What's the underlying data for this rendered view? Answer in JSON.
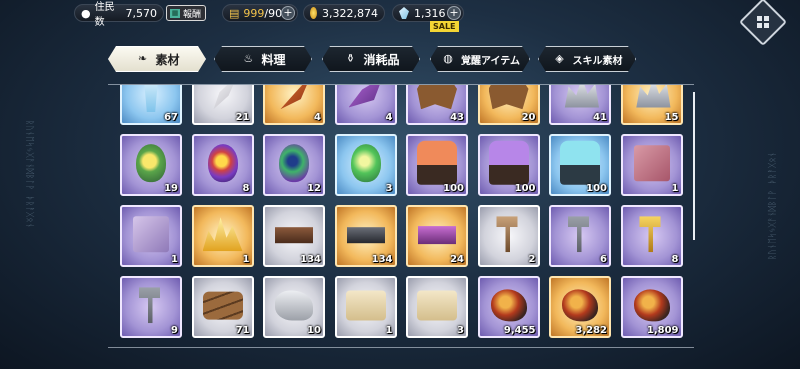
{
  "hud": {
    "population_label": "住民数",
    "population_value": "7,570",
    "report_label": "報酬",
    "bag_value": "999",
    "bag_max": "/90",
    "gold_value": "3,322,874",
    "gem_value": "1,316",
    "sale_badge": "SALE",
    "plus": "+"
  },
  "tabs": [
    {
      "label": "素材",
      "icon": "leaf-icon",
      "active": true
    },
    {
      "label": "料理",
      "icon": "pot-icon",
      "active": false
    },
    {
      "label": "消耗品",
      "icon": "potion-icon",
      "active": false
    },
    {
      "label": "覚醒アイテム",
      "icon": "awaken-icon",
      "active": false
    },
    {
      "label": "スキル素材",
      "icon": "skill-icon",
      "active": false
    }
  ],
  "items": [
    {
      "name": "crystal-shard",
      "rarity": "blue",
      "count": "67"
    },
    {
      "name": "white-claw",
      "rarity": "white",
      "count": "21"
    },
    {
      "name": "orange-horn",
      "rarity": "gold",
      "count": "4"
    },
    {
      "name": "purple-feather",
      "rarity": "purple",
      "count": "4"
    },
    {
      "name": "beast-hide",
      "rarity": "purple",
      "count": "43"
    },
    {
      "name": "brown-pelt",
      "rarity": "gold",
      "count": "20"
    },
    {
      "name": "silver-ore",
      "rarity": "purple",
      "count": "41"
    },
    {
      "name": "blue-crystal-cluster",
      "rarity": "gold",
      "count": "15"
    },
    {
      "name": "yellow-spirit-gem",
      "rarity": "purple",
      "count": "19"
    },
    {
      "name": "rainbow-spirit-gem",
      "rarity": "purple",
      "count": "8"
    },
    {
      "name": "peacock-spirit-gem",
      "rarity": "purple",
      "count": "12"
    },
    {
      "name": "green-spirit-gem",
      "rarity": "blue",
      "count": "3"
    },
    {
      "name": "red-golem-core",
      "rarity": "purple",
      "count": "100"
    },
    {
      "name": "violet-golem-core",
      "rarity": "purple",
      "count": "100"
    },
    {
      "name": "cyan-golem-core",
      "rarity": "blue",
      "count": "100"
    },
    {
      "name": "red-rune-tablet",
      "rarity": "purple",
      "count": "1"
    },
    {
      "name": "lilac-rune-tablet",
      "rarity": "purple",
      "count": "1"
    },
    {
      "name": "gold-nugget",
      "rarity": "gold",
      "count": "1"
    },
    {
      "name": "bronze-ingot",
      "rarity": "white",
      "count": "134"
    },
    {
      "name": "iron-ingot",
      "rarity": "gold",
      "count": "134"
    },
    {
      "name": "magic-ingot",
      "rarity": "gold",
      "count": "24"
    },
    {
      "name": "wooden-hammer",
      "rarity": "white",
      "count": "2"
    },
    {
      "name": "iron-hammer",
      "rarity": "purple",
      "count": "6"
    },
    {
      "name": "golden-hammer",
      "rarity": "purple",
      "count": "8"
    },
    {
      "name": "war-hammer",
      "rarity": "purple",
      "count": "9"
    },
    {
      "name": "lumber",
      "rarity": "white",
      "count": "71"
    },
    {
      "name": "stone-block",
      "rarity": "white",
      "count": "10"
    },
    {
      "name": "old-map-scroll",
      "rarity": "white",
      "count": "1"
    },
    {
      "name": "treasure-map-scroll",
      "rarity": "white",
      "count": "3"
    },
    {
      "name": "ember-ore",
      "rarity": "purple",
      "count": "9,455"
    },
    {
      "name": "blazing-ore",
      "rarity": "gold",
      "count": "3,282"
    },
    {
      "name": "crimson-ore",
      "rarity": "purple",
      "count": "1,809"
    }
  ]
}
